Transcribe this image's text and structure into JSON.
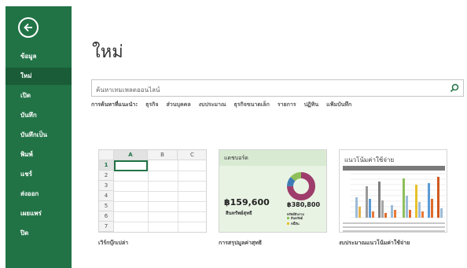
{
  "sidebar": {
    "items": [
      {
        "label": "ข้อมูล",
        "active": false
      },
      {
        "label": "ใหม่",
        "active": true
      },
      {
        "label": "เปิด",
        "active": false
      },
      {
        "label": "บันทึก",
        "active": false
      },
      {
        "label": "บันทึกเป็น",
        "active": false
      },
      {
        "label": "พิมพ์",
        "active": false
      },
      {
        "label": "แชร์",
        "active": false
      },
      {
        "label": "ส่งออก",
        "active": false
      },
      {
        "label": "เผยแพร่",
        "active": false
      },
      {
        "label": "ปิด",
        "active": false
      }
    ]
  },
  "main": {
    "title": "ใหม่",
    "search": {
      "placeholder": "ค้นหาเทมเพลตออนไลน์"
    },
    "suggested": {
      "label": "การค้นหาที่แนะนำ:",
      "links": [
        "ธุรกิจ",
        "ส่วนบุคคล",
        "งบประมาณ",
        "ธุรกิจขนาดเล็ก",
        "รายการ",
        "ปฏิทิน",
        "แฟ้มบันทึก"
      ]
    },
    "templates": [
      {
        "caption": "เวิร์กบุ๊กเปล่า"
      },
      {
        "caption": "การสรุปมูลค่าสุทธิ"
      },
      {
        "caption": "งบประมาณแนวโน้มค่าใช้จ่าย"
      }
    ],
    "blank_grid": {
      "columns": [
        "A",
        "B",
        "C"
      ],
      "rows": [
        "1",
        "2",
        "3",
        "4",
        "5",
        "6",
        "7"
      ]
    },
    "dashboard": {
      "header": "แดชบอร์ด",
      "value1": "฿159,600",
      "value1_label": "สินทรัพย์สุทธิ",
      "value2": "฿380,800",
      "legend_title": "ทรัพย์สินรวม",
      "legend_a": "สินทรัพย์",
      "legend_b": "หนี้สิน"
    },
    "budget": {
      "title": "แนวโน้มค่าใช้จ่าย"
    }
  },
  "colors": {
    "sidebar": "#217346",
    "sidebar_active": "#1a5c37",
    "accent": "#217346"
  }
}
